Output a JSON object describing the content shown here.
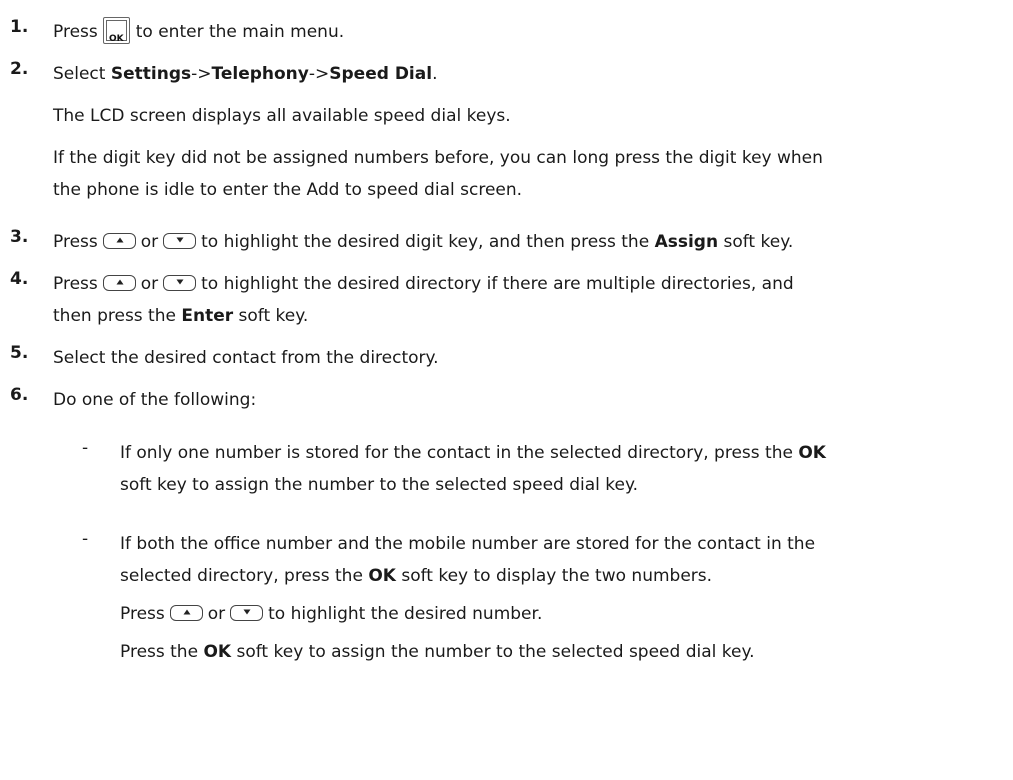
{
  "steps": [
    {
      "num": "1.",
      "pre": "Press",
      "key": "OK",
      "post": "to enter the main menu."
    },
    {
      "num": "2.",
      "select": "Select ",
      "path": [
        "Settings",
        "Telephony",
        "Speed Dial"
      ],
      "sep": "->",
      "end": ".",
      "note1": "The LCD screen displays all available speed dial keys.",
      "note2_line1": "If the digit key did not be assigned numbers before, you can long press the digit key when",
      "note2_line2": "the phone is idle to enter the Add to speed dial screen."
    },
    {
      "num": "3.",
      "pre": "Press",
      "or": "or",
      "post": "to highlight the desired digit key, and then press the ",
      "bold": "Assign",
      "end": " soft key."
    },
    {
      "num": "4.",
      "pre": "Press",
      "or": "or",
      "post": "to highlight the desired directory if there are multiple directories, and",
      "line2_pre": "then press the ",
      "bold": "Enter",
      "end": " soft key."
    },
    {
      "num": "5.",
      "text": "Select the desired contact from the directory."
    },
    {
      "num": "6.",
      "text": "Do one of the following:"
    }
  ],
  "bullets": [
    {
      "dash": "-",
      "line1_pre": "If only one number is stored for the contact in the selected directory, press the ",
      "line1_bold": "OK",
      "line2": "soft key to assign the number to the selected speed dial key."
    },
    {
      "dash": "-",
      "line1": "If both the office number and the mobile number are stored for the contact in the",
      "line2_pre": "selected directory, press the ",
      "line2_bold": "OK",
      "line2_end": " soft key to display the two numbers.",
      "line3_pre": "Press",
      "line3_or": "or",
      "line3_end": "to highlight the desired number.",
      "line4_pre": "Press the ",
      "line4_bold": "OK",
      "line4_end": " soft key to assign the number to the selected speed dial key."
    }
  ],
  "icons": {
    "ok_key": "ok-key-icon",
    "up_key": "up-arrow-key-icon",
    "down_key": "down-arrow-key-icon"
  }
}
